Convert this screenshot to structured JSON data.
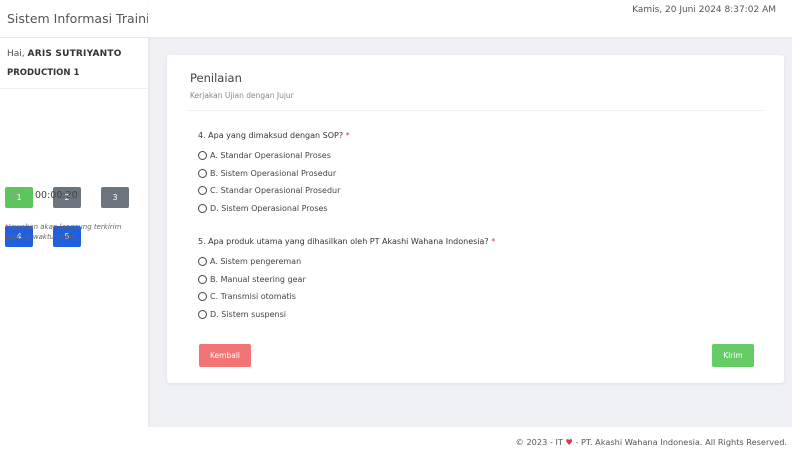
{
  "app": {
    "title": "Sistem Informasi Training"
  },
  "user": {
    "greeting": "Hai,",
    "name": "ARIS SUTRIYANTO",
    "department": "PRODUCTION 1"
  },
  "question_nav": [
    {
      "label": "1",
      "color": "#5cc65c"
    },
    {
      "label": "2",
      "color": "#6c757d"
    },
    {
      "label": "3",
      "color": "#6c757d"
    },
    {
      "label": "4",
      "color": "#1f5fe0"
    },
    {
      "label": "5",
      "color": "#1f5fe0"
    }
  ],
  "timer": {
    "icon": "pencil-icon",
    "value": "00:00:20"
  },
  "note": {
    "asterisk": "*",
    "text": "Jawaban akan langsung terkirim apabila waktu habis"
  },
  "header": {
    "datetime": "Kamis, 20 Juni 2024 8:37:02 AM"
  },
  "card": {
    "title": "Penilaian",
    "subtitle": "Kerjakan Ujian dengan Jujur"
  },
  "questions": [
    {
      "text": "4. Apa yang dimaksud dengan SOP?",
      "required": "*",
      "options": [
        "A. Standar Operasional Proses",
        "B. Sistem Operasional Prosedur",
        "C. Standar Operasional Prosedur",
        "D. Sistem Operasional Proses"
      ]
    },
    {
      "text": "5. Apa produk utama yang dihasilkan oleh PT Akashi Wahana Indonesia?",
      "required": "*",
      "options": [
        "A. Sistem pengereman",
        "B. Manual steering gear",
        "C. Transmisi otomatis",
        "D. Sistem suspensi"
      ]
    }
  ],
  "buttons": {
    "back": "Kembali",
    "submit": "Kirim"
  },
  "footer": {
    "prefix": "© 2023 - IT",
    "heart": "♥",
    "suffix": "- PT. Akashi Wahana Indonesia. All Rights Reserved."
  }
}
